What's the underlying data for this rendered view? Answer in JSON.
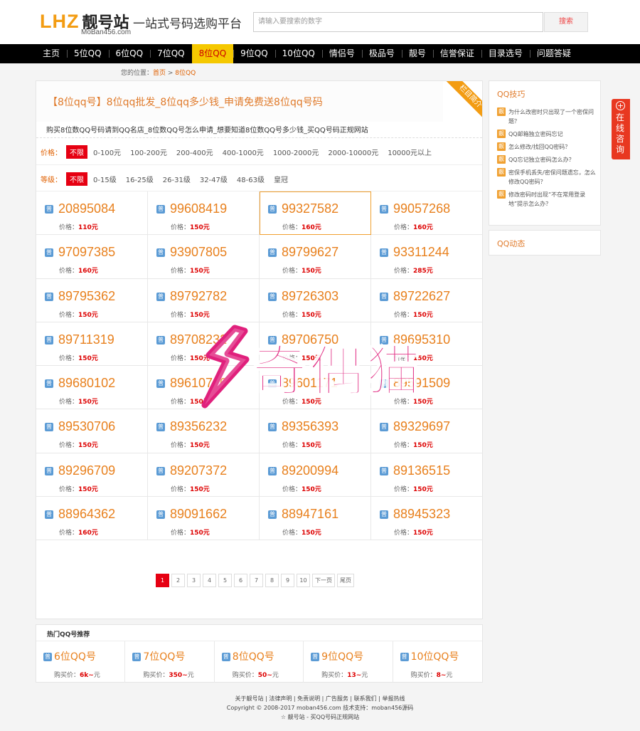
{
  "header": {
    "logo_mark": "LHZ",
    "logo_cn": "靓号站",
    "logo_sub": "MoBan456.com",
    "slogan": "一站式号码选购平台",
    "search_placeholder": "请输入要搜索的数字",
    "search_button": "搜索"
  },
  "nav": [
    "主页",
    "5位QQ",
    "6位QQ",
    "7位QQ",
    "8位QQ",
    "9位QQ",
    "10位QQ",
    "情侣号",
    "极品号",
    "靓号",
    "信誉保证",
    "目录选号",
    "问题答疑"
  ],
  "nav_active": "8位QQ",
  "breadcrumb": {
    "prefix": "您的位置：",
    "home": "首页",
    "sep": " > ",
    "current": "8位QQ"
  },
  "category": {
    "title": "【8位qq号】8位qq批发_8位qq多少钱_申请免费送8位qq号码",
    "ribbon": "栏目简介",
    "desc": "购买8位数QQ号码请到QQ名店_8位数QQ号怎么申请_想要知道8位数QQ号多少钱_买QQ号码正规网站"
  },
  "filters": {
    "price": {
      "label": "价格：",
      "options": [
        "不限",
        "0-100元",
        "100-200元",
        "200-400元",
        "400-1000元",
        "1000-2000元",
        "2000-10000元",
        "10000元以上"
      ]
    },
    "level": {
      "label": "等级：",
      "options": [
        "不限",
        "0-15级",
        "16-25级",
        "26-31级",
        "32-47级",
        "48-63级",
        "皇冠"
      ]
    }
  },
  "badge_normal": "普",
  "price_label": "价格：",
  "numbers": [
    {
      "num": "20895084",
      "price": "110元"
    },
    {
      "num": "99608419",
      "price": "150元"
    },
    {
      "num": "99327582",
      "price": "160元"
    },
    {
      "num": "99057268",
      "price": "160元"
    },
    {
      "num": "97097385",
      "price": "160元"
    },
    {
      "num": "93907805",
      "price": "150元"
    },
    {
      "num": "89799627",
      "price": "150元"
    },
    {
      "num": "93311244",
      "price": "285元"
    },
    {
      "num": "89795362",
      "price": "150元"
    },
    {
      "num": "89792782",
      "price": "150元"
    },
    {
      "num": "89726303",
      "price": "150元"
    },
    {
      "num": "89722627",
      "price": "150元"
    },
    {
      "num": "89711319",
      "price": "150元"
    },
    {
      "num": "89708232",
      "price": "150元"
    },
    {
      "num": "89706750",
      "price": "150元"
    },
    {
      "num": "89695310",
      "price": "150元"
    },
    {
      "num": "89680102",
      "price": "150元"
    },
    {
      "num": "89610710",
      "price": "150元"
    },
    {
      "num": "89601171",
      "price": "150元"
    },
    {
      "num": "89591509",
      "price": "150元"
    },
    {
      "num": "89530706",
      "price": "150元"
    },
    {
      "num": "89356232",
      "price": "150元"
    },
    {
      "num": "89356393",
      "price": "150元"
    },
    {
      "num": "89329697",
      "price": "150元"
    },
    {
      "num": "89296709",
      "price": "150元"
    },
    {
      "num": "89207372",
      "price": "150元"
    },
    {
      "num": "89200994",
      "price": "150元"
    },
    {
      "num": "89136515",
      "price": "150元"
    },
    {
      "num": "88964362",
      "price": "160元"
    },
    {
      "num": "89091662",
      "price": "150元"
    },
    {
      "num": "88947161",
      "price": "150元"
    },
    {
      "num": "88945323",
      "price": "150元"
    }
  ],
  "pagination": [
    "1",
    "2",
    "3",
    "4",
    "5",
    "6",
    "7",
    "8",
    "9",
    "10",
    "下一页",
    "尾页"
  ],
  "hot": {
    "title": "热门QQ号推荐",
    "price_label": "购买价：",
    "items": [
      {
        "name": "6位QQ号",
        "price": "6k~",
        "unit": "元"
      },
      {
        "name": "7位QQ号",
        "price": "350~",
        "unit": "元"
      },
      {
        "name": "8位QQ号",
        "price": "50~",
        "unit": "元"
      },
      {
        "name": "9位QQ号",
        "price": "13~",
        "unit": "元"
      },
      {
        "name": "10位QQ号",
        "price": "8~",
        "unit": "元"
      }
    ]
  },
  "sidebar": {
    "tips_title": "QQ技巧",
    "tip_badge": "靓",
    "tips": [
      "为什么改密时只出现了一个密保问题？",
      "QQ邮箱独立密码忘记",
      "怎么修改/找回QQ密码？",
      "QQ忘记独立密码怎么办？",
      "密保手机丢失/密保问题遗忘，怎么修改QQ密码？",
      "修改密码时出现“不在常用登录地”提示怎么办？"
    ],
    "news_title": "QQ动态"
  },
  "consult": {
    "plus": "+",
    "text": "在线咨询"
  },
  "footer": {
    "links": "关于靓号站 | 法律声明 | 免责说明 | 广告服务 | 联系我们 | 举报热线",
    "copyright": "Copyright © 2008-2017 moban456.com 技术支持：moban456源码",
    "tagline": "☆ 靓号站 - 买QQ号码正规网站"
  },
  "watermark": "奇偶猫"
}
